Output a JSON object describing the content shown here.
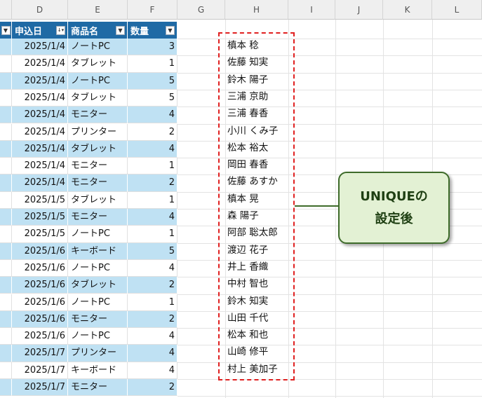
{
  "columns": [
    "D",
    "E",
    "F",
    "G",
    "H",
    "I",
    "J",
    "K",
    "L"
  ],
  "table": {
    "headers": {
      "date": "申込日",
      "product": "商品名",
      "qty": "数量"
    },
    "rows": [
      {
        "date": "2025/1/4",
        "product": "ノートPC",
        "qty": "3"
      },
      {
        "date": "2025/1/4",
        "product": "タブレット",
        "qty": "1"
      },
      {
        "date": "2025/1/4",
        "product": "ノートPC",
        "qty": "5"
      },
      {
        "date": "2025/1/4",
        "product": "タブレット",
        "qty": "5"
      },
      {
        "date": "2025/1/4",
        "product": "モニター",
        "qty": "4"
      },
      {
        "date": "2025/1/4",
        "product": "プリンター",
        "qty": "2"
      },
      {
        "date": "2025/1/4",
        "product": "タブレット",
        "qty": "4"
      },
      {
        "date": "2025/1/4",
        "product": "モニター",
        "qty": "1"
      },
      {
        "date": "2025/1/4",
        "product": "モニター",
        "qty": "2"
      },
      {
        "date": "2025/1/5",
        "product": "タブレット",
        "qty": "1"
      },
      {
        "date": "2025/1/5",
        "product": "モニター",
        "qty": "4"
      },
      {
        "date": "2025/1/5",
        "product": "ノートPC",
        "qty": "1"
      },
      {
        "date": "2025/1/6",
        "product": "キーボード",
        "qty": "5"
      },
      {
        "date": "2025/1/6",
        "product": "ノートPC",
        "qty": "4"
      },
      {
        "date": "2025/1/6",
        "product": "タブレット",
        "qty": "2"
      },
      {
        "date": "2025/1/6",
        "product": "ノートPC",
        "qty": "1"
      },
      {
        "date": "2025/1/6",
        "product": "モニター",
        "qty": "2"
      },
      {
        "date": "2025/1/6",
        "product": "ノートPC",
        "qty": "4"
      },
      {
        "date": "2025/1/7",
        "product": "プリンター",
        "qty": "4"
      },
      {
        "date": "2025/1/7",
        "product": "キーボード",
        "qty": "4"
      },
      {
        "date": "2025/1/7",
        "product": "モニター",
        "qty": "2"
      }
    ]
  },
  "unique_names": [
    "槙本 稔",
    "佐藤 知実",
    "鈴木 陽子",
    "三浦 京助",
    "三浦 春香",
    "小川 くみ子",
    "松本 裕太",
    "岡田 春香",
    "佐藤 あすか",
    "槙本 晃",
    "森 陽子",
    "阿部 聡太郎",
    "渡辺 花子",
    "井上 香織",
    "中村 智也",
    "鈴木 知実",
    "山田 千代",
    "松本 和也",
    "山崎 修平",
    "村上 美加子"
  ],
  "callout": {
    "line1": "UNIQUEの",
    "line2": "設定後"
  },
  "colors": {
    "band": "#bfe1f3",
    "header": "#1f6aa5",
    "dash": "#e02020",
    "callout_fill": "#e3f1d4",
    "callout_border": "#3e6b2a"
  },
  "icons": {
    "filter": "filter-dropdown-icon",
    "sort_filter": "sort-filter-dropdown-icon"
  }
}
